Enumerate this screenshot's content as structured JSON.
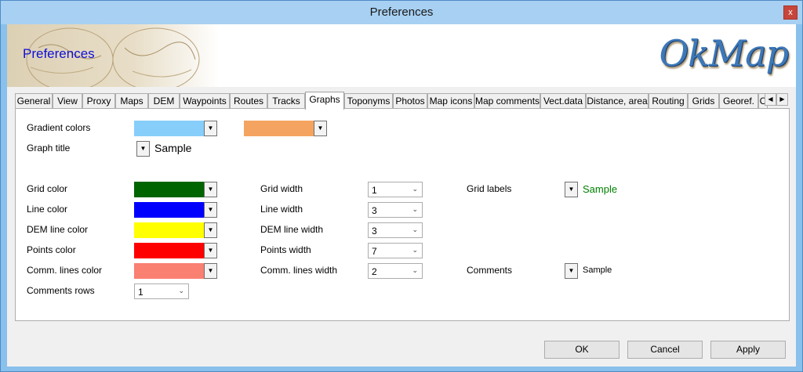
{
  "window": {
    "title": "Preferences",
    "close_glyph": "x"
  },
  "banner": {
    "title": "Preferences",
    "logo": "OkMap"
  },
  "tabs": [
    "General",
    "View",
    "Proxy",
    "Maps",
    "DEM",
    "Waypoints",
    "Routes",
    "Tracks",
    "Graphs",
    "Toponyms",
    "Photos",
    "Map icons",
    "Map comments",
    "Vect.data",
    "Distance, area",
    "Routing",
    "Grids",
    "Georef.",
    "C"
  ],
  "active_tab": "Graphs",
  "graphs": {
    "gradient_colors": {
      "label": "Gradient colors",
      "color1": "#87cefa",
      "color2": "#f4a460"
    },
    "graph_title": {
      "label": "Graph title",
      "sample": "Sample"
    },
    "grid_color": {
      "label": "Grid color",
      "color": "#006400"
    },
    "line_color": {
      "label": "Line color",
      "color": "#0000ff"
    },
    "dem_line_color": {
      "label": "DEM line color",
      "color": "#ffff00"
    },
    "points_color": {
      "label": "Points color",
      "color": "#ff0000"
    },
    "comm_lines_color": {
      "label": "Comm. lines color",
      "color": "#fa8072"
    },
    "comments_rows": {
      "label": "Comments rows",
      "value": "1"
    },
    "grid_width": {
      "label": "Grid width",
      "value": "1"
    },
    "line_width": {
      "label": "Line width",
      "value": "3"
    },
    "dem_line_width": {
      "label": "DEM line width",
      "value": "3"
    },
    "points_width": {
      "label": "Points width",
      "value": "7"
    },
    "comm_lines_width": {
      "label": "Comm. lines width",
      "value": "2"
    },
    "grid_labels": {
      "label": "Grid labels",
      "sample": "Sample",
      "sample_color": "#008000"
    },
    "comments": {
      "label": "Comments",
      "sample": "Sample"
    }
  },
  "buttons": {
    "ok": "OK",
    "cancel": "Cancel",
    "apply": "Apply"
  },
  "icons": {
    "dropdown": "chevron-down-icon",
    "tab_left": "chevron-left-icon",
    "tab_right": "chevron-right-icon"
  }
}
